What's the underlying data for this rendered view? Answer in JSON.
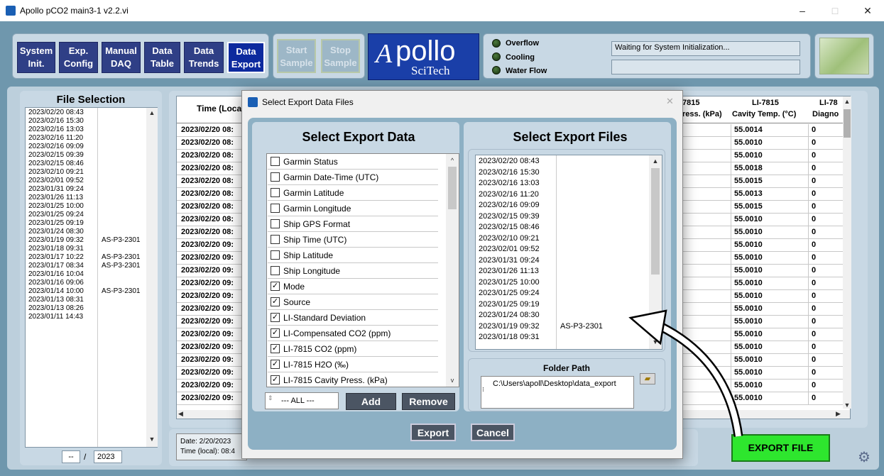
{
  "window": {
    "title": "Apollo pCO2 main3-1 v2.2.vi",
    "minimize": "–",
    "maximize": "□",
    "close": "✕"
  },
  "tabs": [
    {
      "label1": "System",
      "label2": "Init."
    },
    {
      "label1": "Exp.",
      "label2": "Config"
    },
    {
      "label1": "Manual",
      "label2": "DAQ"
    },
    {
      "label1": "Data",
      "label2": "Table"
    },
    {
      "label1": "Data",
      "label2": "Trends"
    },
    {
      "label1": "Data",
      "label2": "Export"
    }
  ],
  "sample": {
    "start1": "Start",
    "start2": "Sample",
    "stop1": "Stop",
    "stop2": "Sample"
  },
  "logo": {
    "word": "pollo",
    "letter": "A",
    "sub": "SciTech"
  },
  "indicators": [
    {
      "label": "Overflow"
    },
    {
      "label": "Cooling"
    },
    {
      "label": "Water Flow"
    }
  ],
  "status": {
    "message": "Waiting for System Initialization...",
    "message2": ""
  },
  "file_selection": {
    "title": "File Selection",
    "files": [
      {
        "date": "2023/02/20 08:43",
        "tag": ""
      },
      {
        "date": "2023/02/16 15:30",
        "tag": ""
      },
      {
        "date": "2023/02/16 13:03",
        "tag": ""
      },
      {
        "date": "2023/02/16 11:20",
        "tag": ""
      },
      {
        "date": "2023/02/16 09:09",
        "tag": ""
      },
      {
        "date": "2023/02/15 09:39",
        "tag": ""
      },
      {
        "date": "2023/02/15 08:46",
        "tag": ""
      },
      {
        "date": "2023/02/10 09:21",
        "tag": ""
      },
      {
        "date": "2023/02/01 09:52",
        "tag": ""
      },
      {
        "date": "2023/01/31 09:24",
        "tag": ""
      },
      {
        "date": "2023/01/26 11:13",
        "tag": ""
      },
      {
        "date": "2023/01/25 10:00",
        "tag": ""
      },
      {
        "date": "2023/01/25 09:24",
        "tag": ""
      },
      {
        "date": "2023/01/25 09:19",
        "tag": ""
      },
      {
        "date": "2023/01/24 08:30",
        "tag": ""
      },
      {
        "date": "2023/01/19 09:32",
        "tag": "AS-P3-2301"
      },
      {
        "date": "2023/01/18 09:31",
        "tag": ""
      },
      {
        "date": "2023/01/17 10:22",
        "tag": "AS-P3-2301"
      },
      {
        "date": "2023/01/17 08:34",
        "tag": "AS-P3-2301"
      },
      {
        "date": "2023/01/16 10:04",
        "tag": ""
      },
      {
        "date": "2023/01/16 09:06",
        "tag": ""
      },
      {
        "date": "2023/01/14 10:00",
        "tag": "AS-P3-2301"
      },
      {
        "date": "2023/01/13 08:31",
        "tag": ""
      },
      {
        "date": "2023/01/13 08:26",
        "tag": ""
      },
      {
        "date": "2023/01/11 14:43",
        "tag": ""
      }
    ],
    "month": "--",
    "slash": "/",
    "year": "2023"
  },
  "data_table": {
    "col_time": "Time (Loca",
    "col_press_1": "7815",
    "col_press_2": "ress. (kPa)",
    "col_temp_1": "LI-7815",
    "col_temp_2": "Cavity Temp. (°C)",
    "col_diag_1": "LI-78",
    "col_diag_2": "Diagno",
    "rows": [
      {
        "time": "2023/02/20  08:",
        "temp": "55.0014",
        "diag": "0"
      },
      {
        "time": "2023/02/20  08:",
        "temp": "55.0010",
        "diag": "0"
      },
      {
        "time": "2023/02/20  08:",
        "temp": "55.0010",
        "diag": "0"
      },
      {
        "time": "2023/02/20  08:",
        "temp": "55.0018",
        "diag": "0"
      },
      {
        "time": "2023/02/20  08:",
        "temp": "55.0015",
        "diag": "0"
      },
      {
        "time": "2023/02/20  08:",
        "temp": "55.0013",
        "diag": "0"
      },
      {
        "time": "2023/02/20  08:",
        "temp": "55.0015",
        "diag": "0"
      },
      {
        "time": "2023/02/20  08:",
        "temp": "55.0010",
        "diag": "0"
      },
      {
        "time": "2023/02/20  08:",
        "temp": "55.0010",
        "diag": "0"
      },
      {
        "time": "2023/02/20  09:",
        "temp": "55.0010",
        "diag": "0"
      },
      {
        "time": "2023/02/20  09:",
        "temp": "55.0010",
        "diag": "0"
      },
      {
        "time": "2023/02/20  09:",
        "temp": "55.0010",
        "diag": "0"
      },
      {
        "time": "2023/02/20  09:",
        "temp": "55.0010",
        "diag": "0"
      },
      {
        "time": "2023/02/20  09:",
        "temp": "55.0010",
        "diag": "0"
      },
      {
        "time": "2023/02/20  09:",
        "temp": "55.0010",
        "diag": "0"
      },
      {
        "time": "2023/02/20  09:",
        "temp": "55.0010",
        "diag": "0"
      },
      {
        "time": "2023/02/20  09:",
        "temp": "55.0010",
        "diag": "0"
      },
      {
        "time": "2023/02/20  09:",
        "temp": "55.0010",
        "diag": "0"
      },
      {
        "time": "2023/02/20  09:",
        "temp": "55.0010",
        "diag": "0"
      },
      {
        "time": "2023/02/20  09:",
        "temp": "55.0010",
        "diag": "0"
      },
      {
        "time": "2023/02/20  09:",
        "temp": "55.0010",
        "diag": "0"
      },
      {
        "time": "2023/02/20  09:",
        "temp": "55.0010",
        "diag": "0"
      }
    ]
  },
  "info": {
    "date": "Date: 2/20/2023",
    "time": "Time (local): 08:4"
  },
  "export_button": "EXPORT FILE",
  "dialog": {
    "title": "Select Export Data Files",
    "left_title": "Select Export Data",
    "right_title": "Select Export Files",
    "fields": [
      {
        "label": "Garmin Status",
        "checked": ""
      },
      {
        "label": "Garmin Date-Time (UTC)",
        "checked": ""
      },
      {
        "label": "Garmin Latitude",
        "checked": ""
      },
      {
        "label": "Garmin Longitude",
        "checked": ""
      },
      {
        "label": "Ship GPS Format",
        "checked": ""
      },
      {
        "label": "Ship Time (UTC)",
        "checked": ""
      },
      {
        "label": "Ship Latitude",
        "checked": ""
      },
      {
        "label": "Ship Longitude",
        "checked": ""
      },
      {
        "label": "Mode",
        "checked": "✓"
      },
      {
        "label": "Source",
        "checked": "✓"
      },
      {
        "label": "LI-Standard Deviation",
        "checked": "✓"
      },
      {
        "label": "LI-Compensated CO2 (ppm)",
        "checked": "✓"
      },
      {
        "label": "LI-7815 CO2 (ppm)",
        "checked": "✓"
      },
      {
        "label": "LI-7815 H2O (‰)",
        "checked": "✓"
      },
      {
        "label": "LI-7815 Cavity Press. (kPa)",
        "checked": "✓"
      }
    ],
    "files": [
      {
        "date": "2023/02/20  08:43",
        "tag": ""
      },
      {
        "date": "2023/02/16  15:30",
        "tag": ""
      },
      {
        "date": "2023/02/16  13:03",
        "tag": ""
      },
      {
        "date": "2023/02/16  11:20",
        "tag": ""
      },
      {
        "date": "2023/02/16  09:09",
        "tag": ""
      },
      {
        "date": "2023/02/15  09:39",
        "tag": ""
      },
      {
        "date": "2023/02/15  08:46",
        "tag": ""
      },
      {
        "date": "2023/02/10  09:21",
        "tag": ""
      },
      {
        "date": "2023/02/01  09:52",
        "tag": ""
      },
      {
        "date": "2023/01/31  09:24",
        "tag": ""
      },
      {
        "date": "2023/01/26  11:13",
        "tag": ""
      },
      {
        "date": "2023/01/25  10:00",
        "tag": ""
      },
      {
        "date": "2023/01/25  09:24",
        "tag": ""
      },
      {
        "date": "2023/01/25  09:19",
        "tag": ""
      },
      {
        "date": "2023/01/24  08:30",
        "tag": ""
      },
      {
        "date": "2023/01/19  09:32",
        "tag": "AS-P3-2301"
      },
      {
        "date": "2023/01/18  09:31",
        "tag": ""
      }
    ],
    "selector_value": "--- ALL ---",
    "add": "Add",
    "remove": "Remove",
    "folder_title": "Folder Path",
    "folder_path": "C:\\Users\\apoll\\Desktop\\data_export",
    "export": "Export",
    "cancel": "Cancel"
  },
  "colors": {
    "accent_green": "#2ee62e",
    "tab_blue": "#2f3f86",
    "panel_bg": "#6f97ad"
  }
}
